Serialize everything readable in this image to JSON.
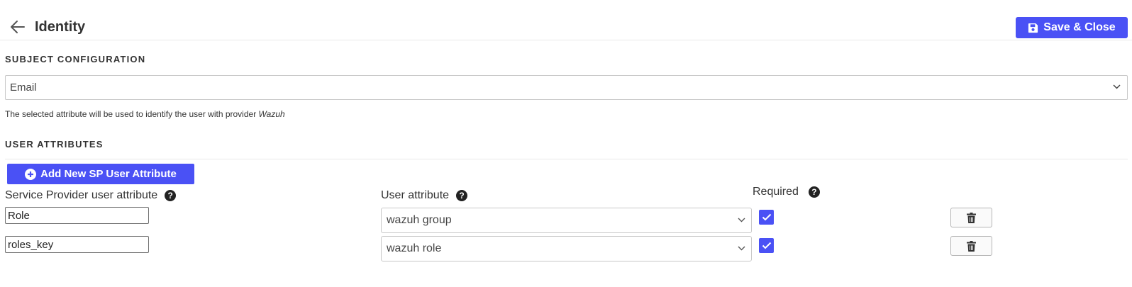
{
  "header": {
    "title": "Identity",
    "back_icon": "arrow-left-icon",
    "save_label": "Save & Close",
    "save_icon": "floppy-disk-icon"
  },
  "subject_configuration": {
    "section_title": "SUBJECT CONFIGURATION",
    "selected_value": "Email",
    "hint_prefix": "The selected attribute will be used to identify the user with provider ",
    "hint_provider": "Wazuh"
  },
  "user_attributes": {
    "section_title": "USER ATTRIBUTES",
    "add_label": "Add New SP User Attribute",
    "add_icon": "plus-circle-icon",
    "columns": {
      "sp_attribute": "Service Provider user attribute",
      "user_attribute": "User attribute",
      "required": "Required"
    },
    "rows": [
      {
        "sp_attribute": "Role",
        "user_attribute": "wazuh group",
        "required": true
      },
      {
        "sp_attribute": "roles_key",
        "user_attribute": "wazuh role",
        "required": true
      }
    ]
  },
  "colors": {
    "accent": "#4a51f5",
    "border": "#c8c8c8",
    "text": "#333333"
  }
}
